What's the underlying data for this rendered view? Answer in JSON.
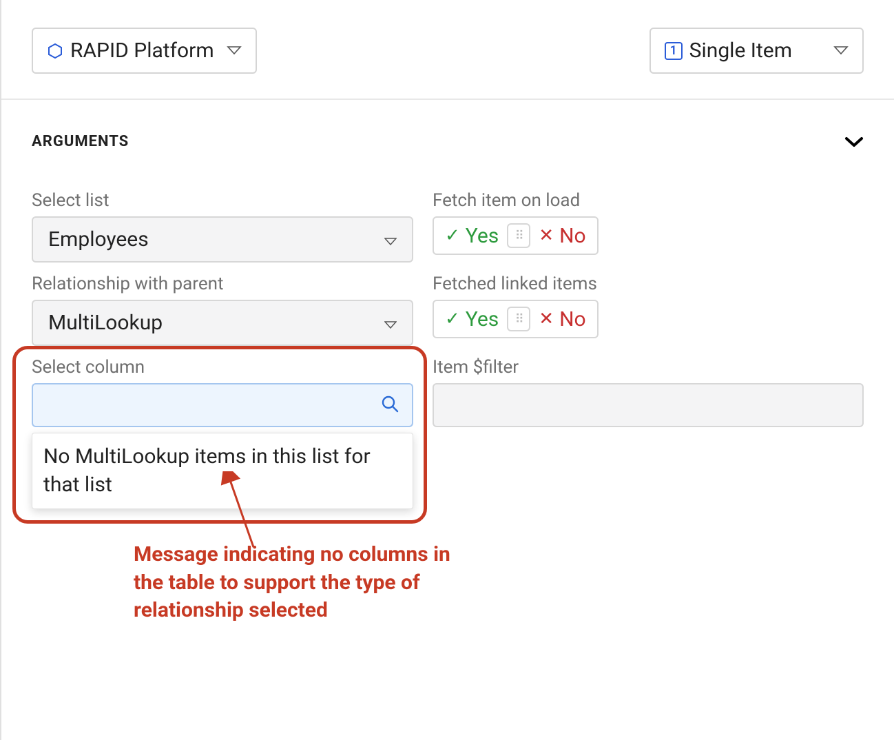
{
  "header": {
    "platform_label": "RAPID Platform",
    "scope_label": "Single Item",
    "scope_count": "1"
  },
  "arguments_section": {
    "title": "ARGUMENTS",
    "select_list": {
      "label": "Select list",
      "value": "Employees"
    },
    "fetch_on_load": {
      "label": "Fetch item on load",
      "yes": "Yes",
      "no": "No"
    },
    "relationship": {
      "label": "Relationship with parent",
      "value": "MultiLookup"
    },
    "fetched_linked": {
      "label": "Fetched linked items",
      "yes": "Yes",
      "no": "No"
    },
    "select_column": {
      "label": "Select column",
      "empty_message": "No MultiLookup items in this list for that list"
    },
    "item_filter": {
      "label": "Item $filter"
    }
  },
  "annotation": {
    "text": "Message indicating no columns in the table to support the type of relationship selected"
  }
}
